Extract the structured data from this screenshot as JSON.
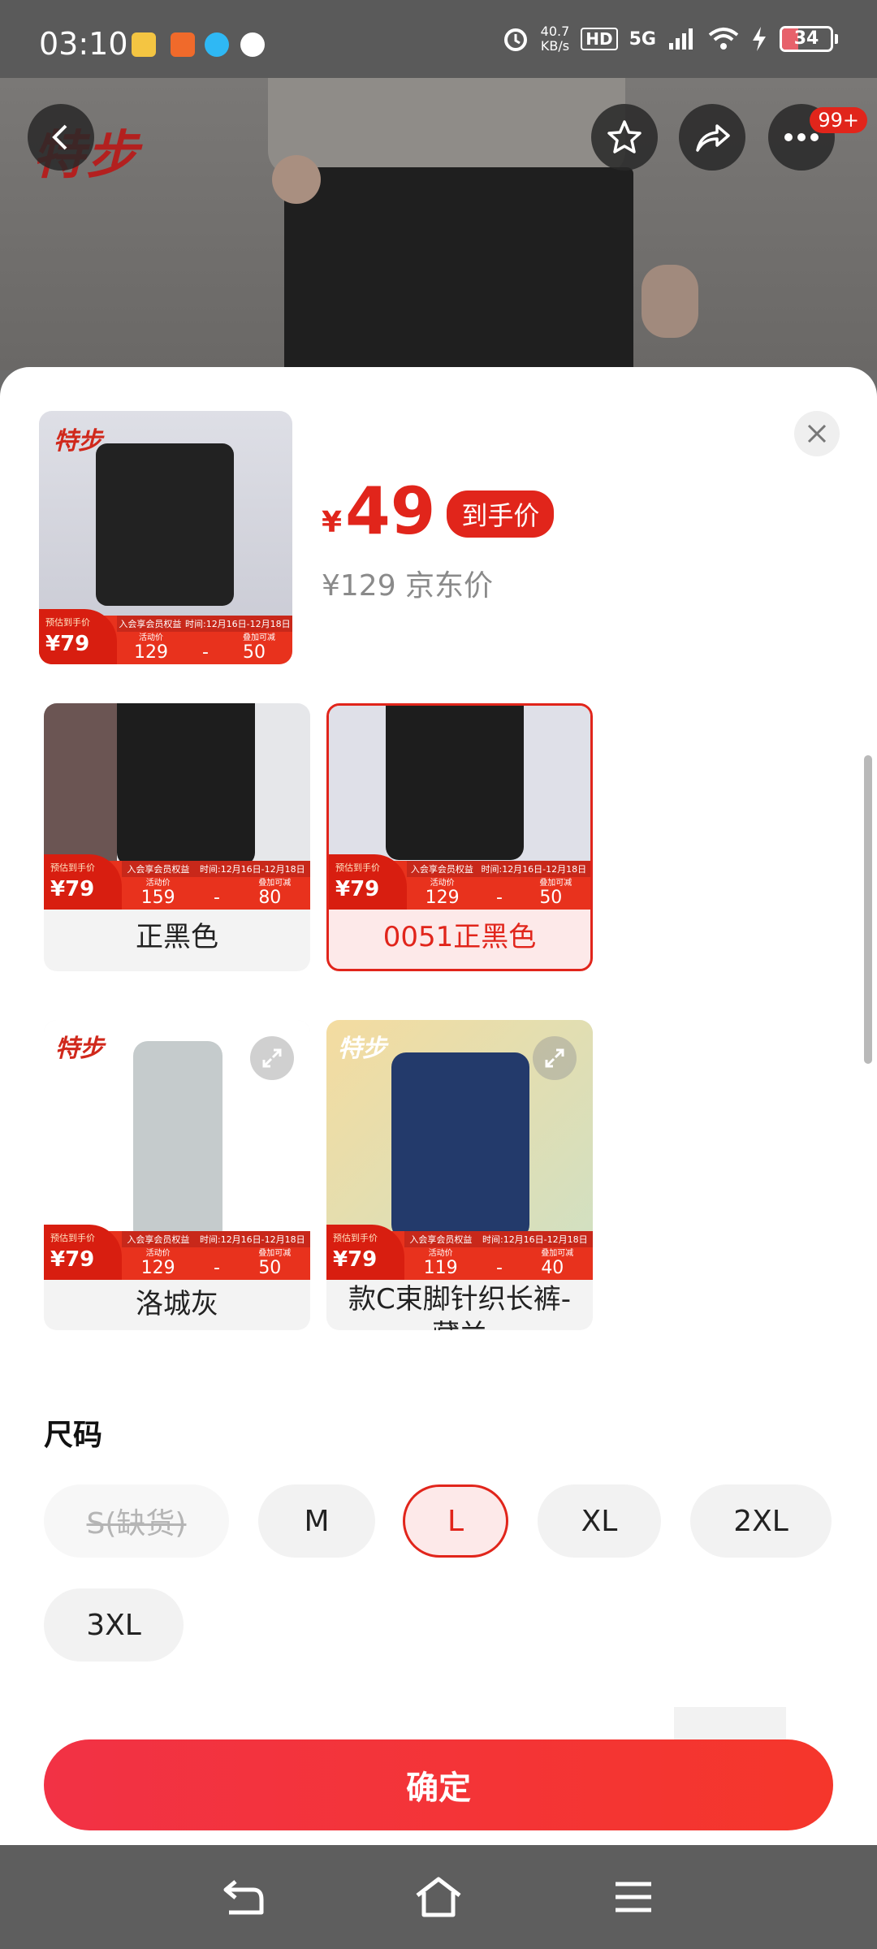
{
  "status_bar": {
    "time": "03:10",
    "net_speed_value": "40.7",
    "net_speed_unit": "KB/s",
    "hd": "HD",
    "network": "5G",
    "battery": "34"
  },
  "header": {
    "brand_logo_text": "特步",
    "more_badge": "99+"
  },
  "product": {
    "final_price_symbol": "¥",
    "final_price": "49",
    "final_price_tag": "到手价",
    "jd_price": "¥129 京东价"
  },
  "variants": [
    {
      "label": "正黑色",
      "est_label": "预估到手价",
      "est_price": "¥79",
      "activity_price": "159",
      "discount": "80",
      "selected": false
    },
    {
      "label": "0051正黑色",
      "est_label": "预估到手价",
      "est_price": "¥79",
      "activity_price": "129",
      "discount": "50",
      "selected": true
    },
    {
      "label": "洛城灰",
      "est_label": "预估到手价",
      "est_price": "¥79",
      "activity_price": "129",
      "discount": "50",
      "selected": false
    },
    {
      "label": "款C束脚针织长裤-藏兰",
      "est_label": "预估到手价",
      "est_price": "¥79",
      "activity_price": "119",
      "discount": "40",
      "selected": false
    }
  ],
  "main_thumb_promo": {
    "est_label": "预估到手价",
    "est_price": "¥79",
    "activity_price": "129",
    "discount": "50"
  },
  "promo_labels": {
    "member": "入会享会员权益",
    "time": "时间:12月16日-12月18日",
    "activity": "活动价",
    "stack": "叠加可减"
  },
  "size": {
    "title": "尺码",
    "options": [
      "S(缺货)",
      "M",
      "L",
      "XL",
      "2XL",
      "3XL"
    ],
    "selected": "L",
    "out_of_stock": "S(缺货)"
  },
  "confirm_button": "确定",
  "colors": {
    "accent": "#e1251b",
    "selected_bg": "#fde9e9"
  }
}
